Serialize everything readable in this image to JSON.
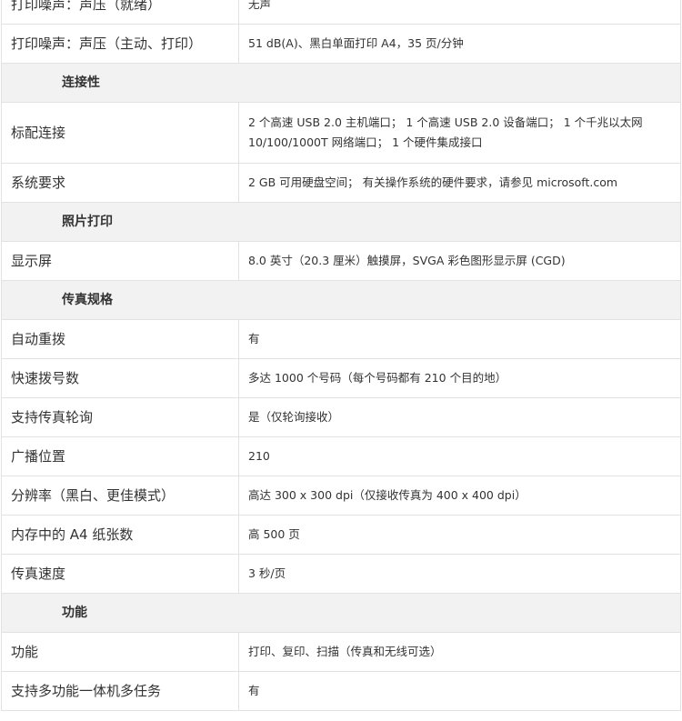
{
  "sections": [
    {
      "title": "",
      "rows": [
        {
          "label": "打印噪声：声压（就绪）",
          "value": "无声"
        },
        {
          "label": "打印噪声：声压（主动、打印）",
          "value": "51 dB(A)、黑白单面打印 A4，35 页/分钟"
        }
      ]
    },
    {
      "title": "连接性",
      "rows": [
        {
          "label": "标配连接",
          "value": "2 个高速 USB 2.0 主机端口； 1 个高速 USB 2.0 设备端口； 1 个千兆以太网 10/100/1000T 网络端口； 1 个硬件集成接口"
        },
        {
          "label": "系统要求",
          "value": "2 GB 可用硬盘空间； 有关操作系统的硬件要求，请参见 microsoft.com"
        }
      ]
    },
    {
      "title": "照片打印",
      "rows": [
        {
          "label": "显示屏",
          "value": "8.0 英寸（20.3 厘米）触摸屏，SVGA 彩色图形显示屏 (CGD)"
        }
      ]
    },
    {
      "title": "传真规格",
      "rows": [
        {
          "label": "自动重拨",
          "value": "有"
        },
        {
          "label": "快速拨号数",
          "value": "多达 1000 个号码（每个号码都有 210 个目的地）"
        },
        {
          "label": "支持传真轮询",
          "value": "是（仅轮询接收）"
        },
        {
          "label": "广播位置",
          "value": "210"
        },
        {
          "label": "分辨率（黑白、更佳模式）",
          "value": "高达 300 x 300 dpi（仅接收传真为 400 x 400 dpi）"
        },
        {
          "label": "内存中的 A4 纸张数",
          "value": "高 500 页"
        },
        {
          "label": "传真速度",
          "value": "3 秒/页"
        }
      ]
    },
    {
      "title": "功能",
      "rows": [
        {
          "label": "功能",
          "value": "打印、复印、扫描（传真和无线可选）"
        },
        {
          "label": "支持多功能一体机多任务",
          "value": "有"
        }
      ]
    }
  ]
}
